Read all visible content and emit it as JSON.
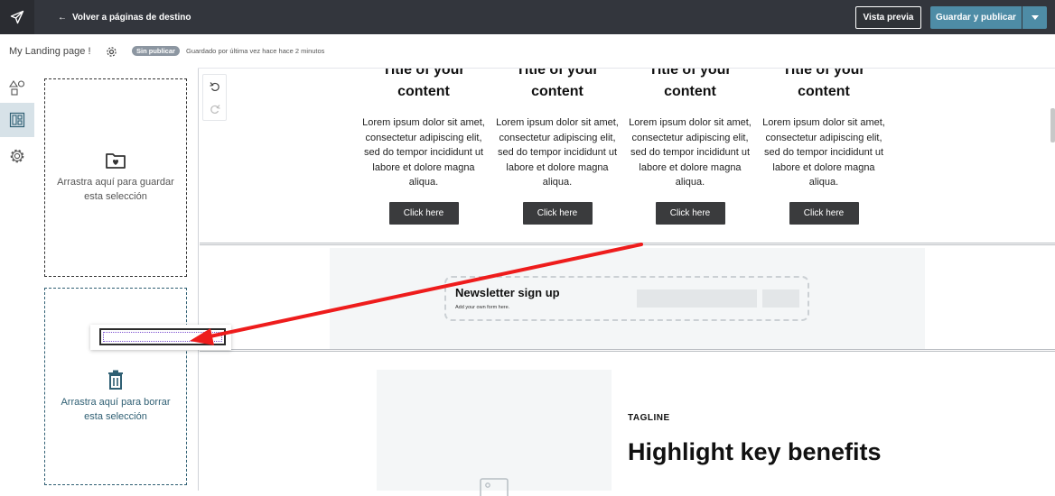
{
  "topbar": {
    "back_label": "Volver a páginas de destino",
    "preview_label": "Vista previa",
    "publish_label": "Guardar y publicar",
    "accent_color": "#4e8ca6"
  },
  "subbar": {
    "page_name": "My Landing page !",
    "status_badge": "Sin publicar",
    "saved_text": "Guardado por última vez hace hace 2 minutos"
  },
  "rail": {
    "items": [
      {
        "icon": "shapes-icon"
      },
      {
        "icon": "layout-icon",
        "active": true
      },
      {
        "icon": "settings-icon"
      }
    ]
  },
  "dropzones": {
    "save_text": "Arrastra aquí para guardar esta selección",
    "delete_text": "Arrastra aquí para borrar esta selección"
  },
  "columns": [
    {
      "title": "Title of your content",
      "body": "Lorem ipsum dolor sit amet, consectetur adipiscing elit, sed do tempor incididunt ut labore et dolore magna aliqua.",
      "button": "Click here"
    },
    {
      "title": "Title of your content",
      "body": "Lorem ipsum dolor sit amet, consectetur adipiscing elit, sed do tempor incididunt ut labore et dolore magna aliqua.",
      "button": "Click here"
    },
    {
      "title": "Title of your content",
      "body": "Lorem ipsum dolor sit amet, consectetur adipiscing elit, sed do tempor incididunt ut labore et dolore magna aliqua.",
      "button": "Click here"
    },
    {
      "title": "Title of your content",
      "body": "Lorem ipsum dolor sit amet, consectetur adipiscing elit, sed do tempor incididunt ut labore et dolore magna aliqua.",
      "button": "Click here"
    }
  ],
  "newsletter": {
    "title": "Newsletter sign up",
    "subtitle": "Add your own form here."
  },
  "benefits": {
    "tagline": "TAGLINE",
    "headline": "Highlight key benefits"
  },
  "annotation_color": "#ee1c1c"
}
